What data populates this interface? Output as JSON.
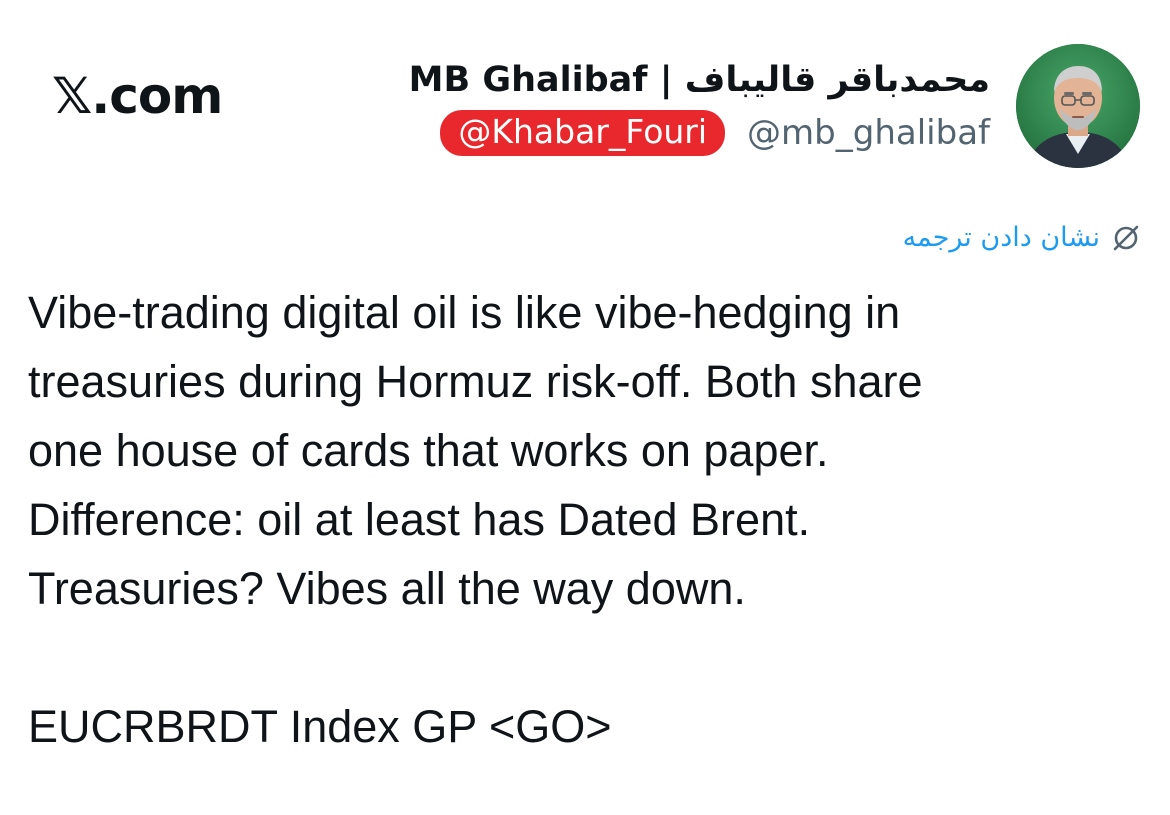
{
  "brand": {
    "label": "𝕏.com"
  },
  "author": {
    "display_name": "MB Ghalibaf | محمدباقر قالیباف",
    "handle": "@mb_ghalibaf",
    "avatar_icon": "profile-photo"
  },
  "watermark": {
    "label": "@Khabar_Fouri",
    "color": "#e8282c"
  },
  "translate": {
    "label": "نشان دادن ترجمه",
    "icon": "globe-translate-icon",
    "color": "#1d9bf0"
  },
  "tweet": {
    "lines": [
      "Vibe-trading digital oil is like vibe-hedging in",
      "treasuries during Hormuz risk-off. Both share",
      "one house of cards that works on paper.",
      "Difference: oil at least has Dated Brent.",
      "Treasuries? Vibes all the way down."
    ],
    "footer": "EUCRBRDT Index GP <GO>"
  }
}
